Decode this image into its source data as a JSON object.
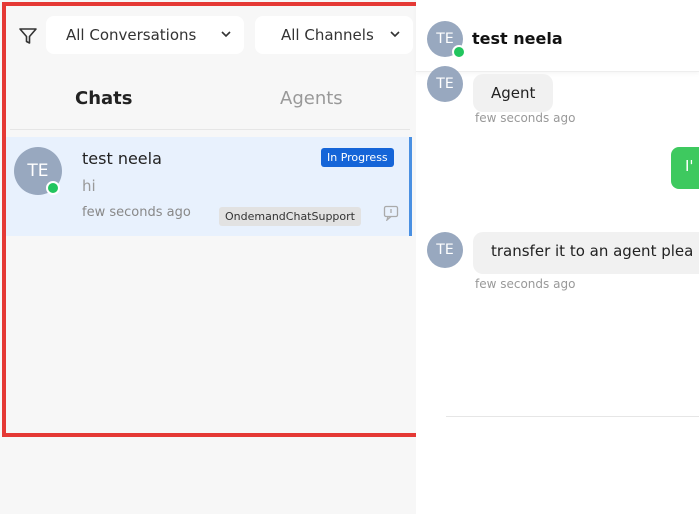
{
  "filters": {
    "conversations_label": "All Conversations",
    "channels_label": "All Channels"
  },
  "tabs": {
    "chats": "Chats",
    "agents": "Agents"
  },
  "chat_list": [
    {
      "avatar_initials": "TE",
      "name": "test neela",
      "status": "In Progress",
      "preview": "hi",
      "time": "few seconds ago",
      "channel": "OndemandChatSupport"
    }
  ],
  "conversation": {
    "avatar_initials": "TE",
    "title": "test neela",
    "messages": [
      {
        "avatar": "TE",
        "text": "Agent",
        "time": "few seconds ago"
      },
      {
        "outgoing_text": "I'"
      },
      {
        "avatar": "TE",
        "text": "transfer it to an agent plea",
        "time": "few seconds ago"
      }
    ]
  },
  "colors": {
    "accent_blue": "#1565d8",
    "online_green": "#22c55e",
    "highlight_frame": "#e53935"
  }
}
